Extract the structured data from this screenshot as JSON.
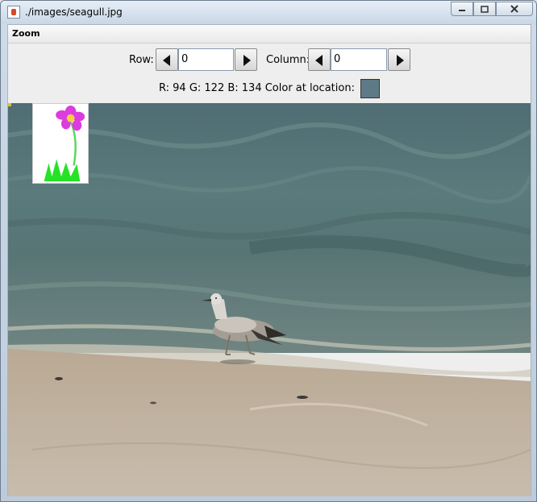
{
  "window": {
    "title": "./images/seagull.jpg"
  },
  "menu": {
    "zoom_label": "Zoom"
  },
  "controls": {
    "row_label": "Row:",
    "row_value": "0",
    "column_label": "Column:",
    "column_value": "0"
  },
  "pixel_info": {
    "text": "R: 94 G: 122 B: 134 Color at location:",
    "swatch_color": "#5e7a86"
  },
  "icons": {
    "minimize": "minimize-icon",
    "maximize": "maximize-icon",
    "close": "close-icon",
    "left_arrow": "left-arrow-icon",
    "right_arrow": "right-arrow-icon"
  }
}
